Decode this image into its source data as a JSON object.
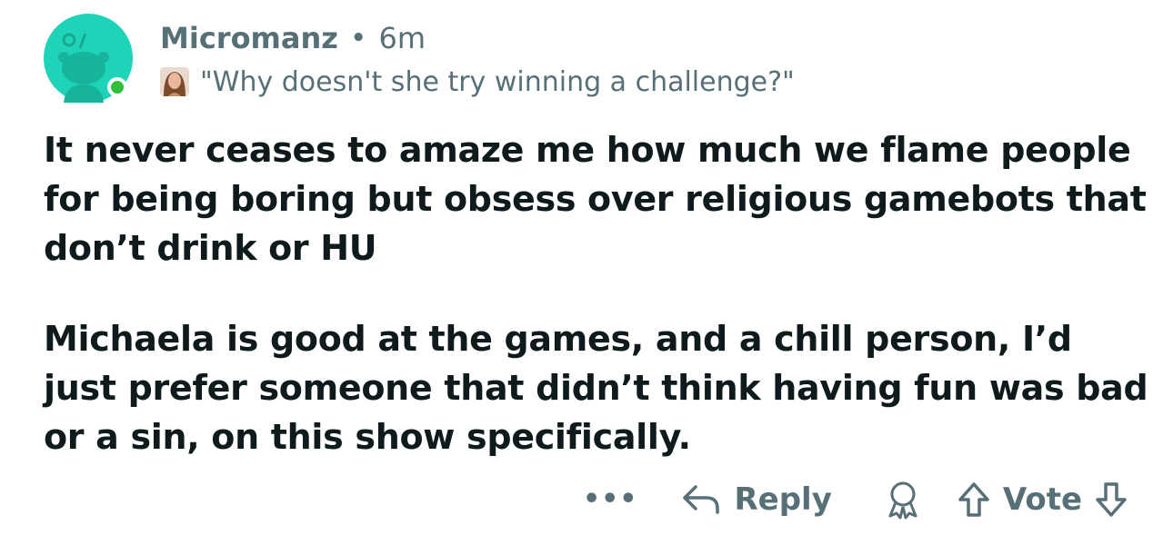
{
  "comment": {
    "author": "Micromanz",
    "separator": "•",
    "time_ago": "6m",
    "flair_text": "\"Why doesn't she try winning a challenge?\"",
    "paragraphs": [
      "It never ceases to amaze me how much we flame people for being boring but obsess over religious gamebots that don’t drink or HU",
      "Michaela is good at the games, and a chill person, I’d just prefer someone that didn’t think having fun was bad or a sin, on this show specifically."
    ]
  },
  "actions": {
    "more_label": "•••",
    "reply_label": "Reply",
    "vote_label": "Vote"
  },
  "colors": {
    "avatar_bg": "#1fd3b8",
    "online": "#2fbf3a",
    "meta_text": "#576f76",
    "body_text": "#0f1a1c"
  },
  "icons": {
    "avatar": "snoo-avatar-icon",
    "flair": "flair-image-icon",
    "more": "more-options-icon",
    "reply": "reply-arrow-icon",
    "award": "award-icon",
    "upvote": "upvote-arrow-icon",
    "downvote": "downvote-arrow-icon"
  }
}
